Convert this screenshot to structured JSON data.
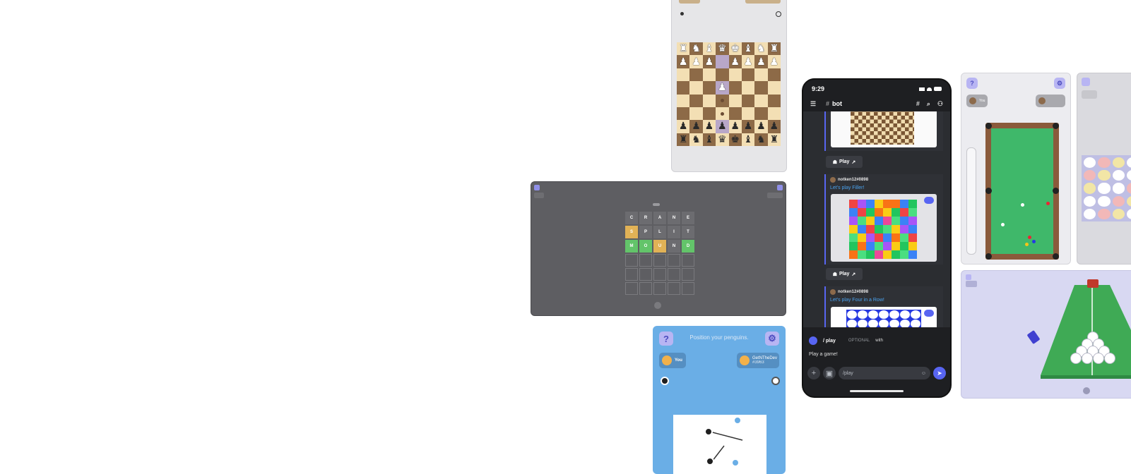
{
  "chess": {
    "board": [
      [
        "♜",
        "♞",
        "♝",
        "♛",
        "♚",
        "♝",
        "♞",
        "♜"
      ],
      [
        "♟",
        "♟",
        "♟",
        "",
        "♟",
        "♟",
        "♟",
        "♟"
      ],
      [
        "",
        "",
        "",
        "",
        "",
        "",
        "",
        ""
      ],
      [
        "",
        "",
        "",
        "♟",
        "",
        "",
        "",
        ""
      ],
      [
        "",
        "",
        "",
        "",
        "",
        "",
        "",
        ""
      ],
      [
        "",
        "",
        "",
        "",
        "",
        "",
        "",
        ""
      ],
      [
        "♟",
        "♟",
        "♟",
        "♟",
        "♟",
        "♟",
        "♟",
        "♟"
      ],
      [
        "♜",
        "♞",
        "♝",
        "♛",
        "♚",
        "♝",
        "♞",
        "♜"
      ]
    ]
  },
  "wordle": {
    "rows": [
      [
        "C",
        "R",
        "A",
        "N",
        "E"
      ],
      [
        "S",
        "P",
        "L",
        "I",
        "T"
      ],
      [
        "M",
        "O",
        "U",
        "N",
        "D"
      ]
    ]
  },
  "penguins": {
    "help_label": "?",
    "prompt": "Position your penguins.",
    "you_label": "You",
    "opponent_name": "GetNTheDev",
    "opponent_tag": "#3963"
  },
  "phone": {
    "time": "9:29",
    "channel": "bot",
    "messages": [
      {
        "author": "notken12#0898",
        "title": "Let's play Filler!"
      },
      {
        "author": "notken12#0898",
        "title": "Let's play Four in a Row!"
      }
    ],
    "play_label": "Play",
    "command": "/ play",
    "optional_label": "OPTIONAL",
    "with_label": "with",
    "command_desc": "Play a game!",
    "input_value": "/play"
  },
  "pool": {
    "help_label": "?",
    "you_label": "You"
  },
  "colors": {
    "discord_blurple": "#5865f2",
    "link_blue": "#4aa3f0",
    "wordle_green": "#63c46a",
    "wordle_yellow": "#e1b256",
    "felt_green": "#3fb86a"
  }
}
